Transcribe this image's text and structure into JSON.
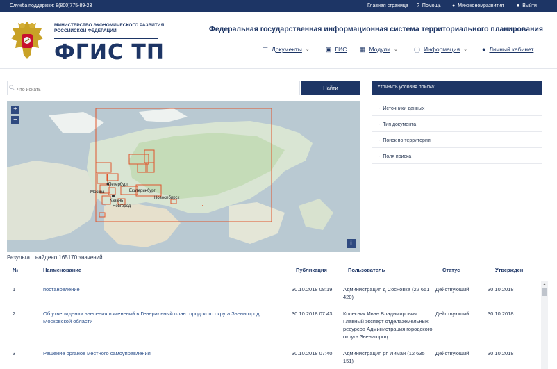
{
  "topbar": {
    "support": "Служба поддержки: 8(800)775-89-23",
    "home": "Главная страница",
    "help": "Помощь",
    "user": "Минэкономразвития",
    "logout": "Выйти"
  },
  "header": {
    "ministry": "Министерство экономического развития Российской Федерации",
    "logo": "ФГИС ТП",
    "system_title": "Федеральная государственная информационная система территориального планирования",
    "nav": [
      {
        "label": "Документы",
        "icon": "database-icon",
        "dropdown": true
      },
      {
        "label": "ГИС",
        "icon": "map-icon",
        "dropdown": false
      },
      {
        "label": "Модули",
        "icon": "grid-icon",
        "dropdown": true
      },
      {
        "label": "Информация",
        "icon": "info-icon",
        "dropdown": true
      },
      {
        "label": "Личный кабинет",
        "icon": "user-icon",
        "dropdown": false
      }
    ]
  },
  "search": {
    "placeholder": "что искать",
    "button": "Найти"
  },
  "filters": {
    "title": "Уточнить условия поиска:",
    "items": [
      "Источники данных",
      "Тип документа",
      "Поиск по территории",
      "Поля поиска"
    ]
  },
  "map": {
    "zoom_in": "+",
    "zoom_out": "−",
    "info": "i",
    "cities": [
      "Петербург",
      "Екатеринбург",
      "Москва",
      "Казань",
      "Новгород",
      "Новосибирск"
    ]
  },
  "result": "Результат: найдено 165170 значений.",
  "table": {
    "headers": [
      "№",
      "Наименование",
      "Публикация",
      "Пользователь",
      "Статус",
      "Утвержден"
    ],
    "rows": [
      {
        "num": "1",
        "name": "постановление",
        "pub": "30.10.2018 08:19",
        "user": "Администрация д Сосновка (22 651 420)",
        "status": "Действующий",
        "approved": "30.10.2018"
      },
      {
        "num": "2",
        "name": "Об утверждении внесения изменений в Генеральный план городского округа Звенигород Московской области",
        "pub": "30.10.2018 07:43",
        "user": "Колесник Иван Владимирович Главный эксперт отделаземельных ресурсов Администрация городского округа Звенигород",
        "status": "Действующий",
        "approved": "30.10.2018"
      },
      {
        "num": "3",
        "name": "Решение органов местного самоуправления",
        "pub": "30.10.2018 07:40",
        "user": "Администрация рп Лиман (12 635 151)",
        "status": "Действующий",
        "approved": "30.10.2018"
      }
    ]
  },
  "colors": {
    "brand": "#1d3565",
    "link": "#2b4f8a",
    "map_highlight": "#e0552c"
  }
}
